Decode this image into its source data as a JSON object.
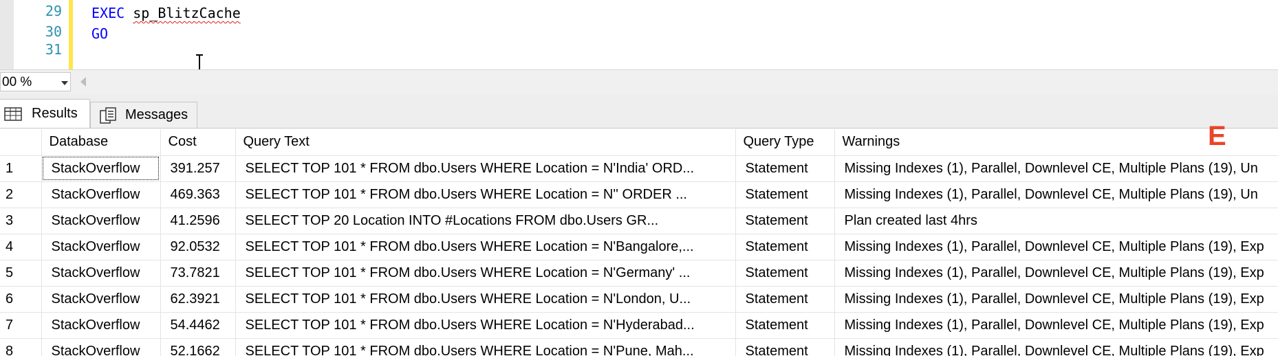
{
  "editor": {
    "line_numbers": [
      "29",
      "30",
      "31"
    ],
    "line29_keyword": "EXEC",
    "line29_proc": "sp_BlitzCache",
    "line30_keyword": "GO"
  },
  "zoom": {
    "value": "00 %"
  },
  "tabs": {
    "results": "Results",
    "messages": "Messages"
  },
  "annotation": {
    "letter": "E",
    "color": "#e8452a"
  },
  "grid": {
    "columns": [
      "",
      "Database",
      "Cost",
      "Query Text",
      "Query Type",
      "Warnings"
    ],
    "rows": [
      [
        "1",
        "StackOverflow",
        "391.257",
        "SELECT TOP 101 * FROM dbo.Users WHERE Location = N'India' ORD...",
        "Statement",
        "Missing Indexes (1), Parallel, Downlevel CE, Multiple Plans (19), Un"
      ],
      [
        "2",
        "StackOverflow",
        "469.363",
        "SELECT TOP 101 * FROM dbo.Users WHERE Location = N'' ORDER ...",
        "Statement",
        "Missing Indexes (1), Parallel, Downlevel CE, Multiple Plans (19), Un"
      ],
      [
        "3",
        "StackOverflow",
        "41.2596",
        "SELECT TOP 20 Location     INTO #Locations     FROM dbo.Users     GR...",
        "Statement",
        "Plan created last 4hrs"
      ],
      [
        "4",
        "StackOverflow",
        "92.0532",
        "SELECT TOP 101 * FROM dbo.Users WHERE Location = N'Bangalore,...",
        "Statement",
        "Missing Indexes (1), Parallel, Downlevel CE, Multiple Plans (19), Exp"
      ],
      [
        "5",
        "StackOverflow",
        "73.7821",
        "SELECT TOP 101 * FROM dbo.Users WHERE Location = N'Germany' ...",
        "Statement",
        "Missing Indexes (1), Parallel, Downlevel CE, Multiple Plans (19), Exp"
      ],
      [
        "6",
        "StackOverflow",
        "62.3921",
        "SELECT TOP 101 * FROM dbo.Users WHERE Location = N'London, U...",
        "Statement",
        "Missing Indexes (1), Parallel, Downlevel CE, Multiple Plans (19), Exp"
      ],
      [
        "7",
        "StackOverflow",
        "54.4462",
        "SELECT TOP 101 * FROM dbo.Users WHERE Location = N'Hyderabad...",
        "Statement",
        "Missing Indexes (1), Parallel, Downlevel CE, Multiple Plans (19), Exp"
      ],
      [
        "8",
        "StackOverflow",
        "52.1662",
        "SELECT TOP 101 * FROM dbo.Users WHERE Location = N'Pune, Mah...",
        "Statement",
        "Missing Indexes (1), Parallel, Downlevel CE, Multiple Plans (19), Exp"
      ]
    ]
  }
}
